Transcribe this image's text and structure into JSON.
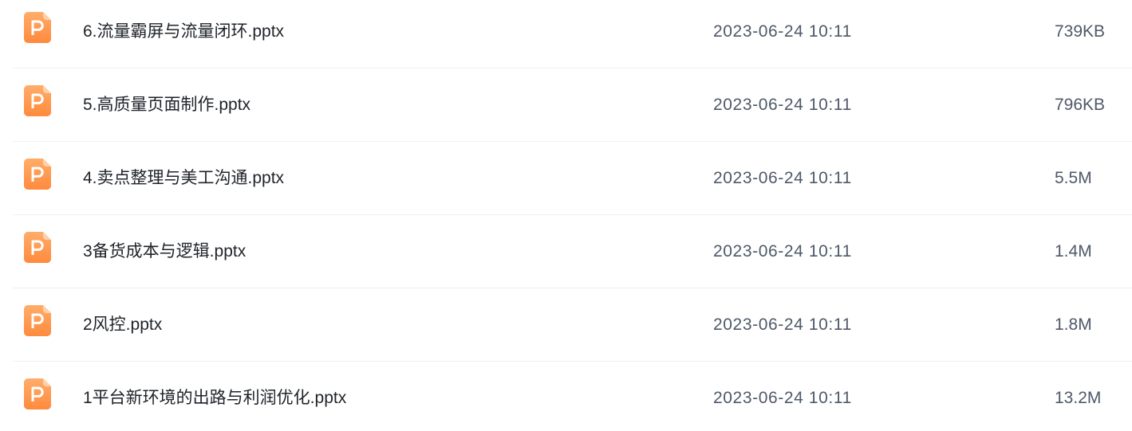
{
  "files": [
    {
      "name": "6.流量霸屏与流量闭环.pptx",
      "date": "2023-06-24 10:11",
      "size": "739KB",
      "icon": "pptx-file-icon"
    },
    {
      "name": "5.高质量页面制作.pptx",
      "date": "2023-06-24 10:11",
      "size": "796KB",
      "icon": "pptx-file-icon"
    },
    {
      "name": "4.卖点整理与美工沟通.pptx",
      "date": "2023-06-24 10:11",
      "size": "5.5M",
      "icon": "pptx-file-icon"
    },
    {
      "name": "3备货成本与逻辑.pptx",
      "date": "2023-06-24 10:11",
      "size": "1.4M",
      "icon": "pptx-file-icon"
    },
    {
      "name": "2风控.pptx",
      "date": "2023-06-24 10:11",
      "size": "1.8M",
      "icon": "pptx-file-icon"
    },
    {
      "name": "1平台新环境的出路与利润优化.pptx",
      "date": "2023-06-24 10:11",
      "size": "13.2M",
      "icon": "pptx-file-icon"
    }
  ],
  "colors": {
    "icon_top": "#ffad6b",
    "icon_bottom": "#ff8a3d",
    "icon_fold": "#ffd0a8",
    "name_text": "#1f2329",
    "meta_text": "#4e5969",
    "divider": "#eef0f3"
  }
}
